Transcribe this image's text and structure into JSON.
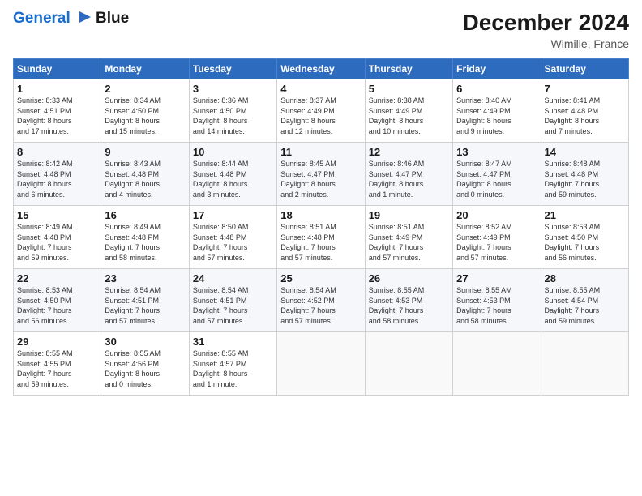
{
  "header": {
    "logo_line1": "General",
    "logo_line2": "Blue",
    "month_title": "December 2024",
    "location": "Wimille, France"
  },
  "days_of_week": [
    "Sunday",
    "Monday",
    "Tuesday",
    "Wednesday",
    "Thursday",
    "Friday",
    "Saturday"
  ],
  "weeks": [
    [
      {
        "day": "1",
        "info": "Sunrise: 8:33 AM\nSunset: 4:51 PM\nDaylight: 8 hours\nand 17 minutes."
      },
      {
        "day": "2",
        "info": "Sunrise: 8:34 AM\nSunset: 4:50 PM\nDaylight: 8 hours\nand 15 minutes."
      },
      {
        "day": "3",
        "info": "Sunrise: 8:36 AM\nSunset: 4:50 PM\nDaylight: 8 hours\nand 14 minutes."
      },
      {
        "day": "4",
        "info": "Sunrise: 8:37 AM\nSunset: 4:49 PM\nDaylight: 8 hours\nand 12 minutes."
      },
      {
        "day": "5",
        "info": "Sunrise: 8:38 AM\nSunset: 4:49 PM\nDaylight: 8 hours\nand 10 minutes."
      },
      {
        "day": "6",
        "info": "Sunrise: 8:40 AM\nSunset: 4:49 PM\nDaylight: 8 hours\nand 9 minutes."
      },
      {
        "day": "7",
        "info": "Sunrise: 8:41 AM\nSunset: 4:48 PM\nDaylight: 8 hours\nand 7 minutes."
      }
    ],
    [
      {
        "day": "8",
        "info": "Sunrise: 8:42 AM\nSunset: 4:48 PM\nDaylight: 8 hours\nand 6 minutes."
      },
      {
        "day": "9",
        "info": "Sunrise: 8:43 AM\nSunset: 4:48 PM\nDaylight: 8 hours\nand 4 minutes."
      },
      {
        "day": "10",
        "info": "Sunrise: 8:44 AM\nSunset: 4:48 PM\nDaylight: 8 hours\nand 3 minutes."
      },
      {
        "day": "11",
        "info": "Sunrise: 8:45 AM\nSunset: 4:47 PM\nDaylight: 8 hours\nand 2 minutes."
      },
      {
        "day": "12",
        "info": "Sunrise: 8:46 AM\nSunset: 4:47 PM\nDaylight: 8 hours\nand 1 minute."
      },
      {
        "day": "13",
        "info": "Sunrise: 8:47 AM\nSunset: 4:47 PM\nDaylight: 8 hours\nand 0 minutes."
      },
      {
        "day": "14",
        "info": "Sunrise: 8:48 AM\nSunset: 4:48 PM\nDaylight: 7 hours\nand 59 minutes."
      }
    ],
    [
      {
        "day": "15",
        "info": "Sunrise: 8:49 AM\nSunset: 4:48 PM\nDaylight: 7 hours\nand 59 minutes."
      },
      {
        "day": "16",
        "info": "Sunrise: 8:49 AM\nSunset: 4:48 PM\nDaylight: 7 hours\nand 58 minutes."
      },
      {
        "day": "17",
        "info": "Sunrise: 8:50 AM\nSunset: 4:48 PM\nDaylight: 7 hours\nand 57 minutes."
      },
      {
        "day": "18",
        "info": "Sunrise: 8:51 AM\nSunset: 4:48 PM\nDaylight: 7 hours\nand 57 minutes."
      },
      {
        "day": "19",
        "info": "Sunrise: 8:51 AM\nSunset: 4:49 PM\nDaylight: 7 hours\nand 57 minutes."
      },
      {
        "day": "20",
        "info": "Sunrise: 8:52 AM\nSunset: 4:49 PM\nDaylight: 7 hours\nand 57 minutes."
      },
      {
        "day": "21",
        "info": "Sunrise: 8:53 AM\nSunset: 4:50 PM\nDaylight: 7 hours\nand 56 minutes."
      }
    ],
    [
      {
        "day": "22",
        "info": "Sunrise: 8:53 AM\nSunset: 4:50 PM\nDaylight: 7 hours\nand 56 minutes."
      },
      {
        "day": "23",
        "info": "Sunrise: 8:54 AM\nSunset: 4:51 PM\nDaylight: 7 hours\nand 57 minutes."
      },
      {
        "day": "24",
        "info": "Sunrise: 8:54 AM\nSunset: 4:51 PM\nDaylight: 7 hours\nand 57 minutes."
      },
      {
        "day": "25",
        "info": "Sunrise: 8:54 AM\nSunset: 4:52 PM\nDaylight: 7 hours\nand 57 minutes."
      },
      {
        "day": "26",
        "info": "Sunrise: 8:55 AM\nSunset: 4:53 PM\nDaylight: 7 hours\nand 58 minutes."
      },
      {
        "day": "27",
        "info": "Sunrise: 8:55 AM\nSunset: 4:53 PM\nDaylight: 7 hours\nand 58 minutes."
      },
      {
        "day": "28",
        "info": "Sunrise: 8:55 AM\nSunset: 4:54 PM\nDaylight: 7 hours\nand 59 minutes."
      }
    ],
    [
      {
        "day": "29",
        "info": "Sunrise: 8:55 AM\nSunset: 4:55 PM\nDaylight: 7 hours\nand 59 minutes."
      },
      {
        "day": "30",
        "info": "Sunrise: 8:55 AM\nSunset: 4:56 PM\nDaylight: 8 hours\nand 0 minutes."
      },
      {
        "day": "31",
        "info": "Sunrise: 8:55 AM\nSunset: 4:57 PM\nDaylight: 8 hours\nand 1 minute."
      },
      null,
      null,
      null,
      null
    ]
  ]
}
